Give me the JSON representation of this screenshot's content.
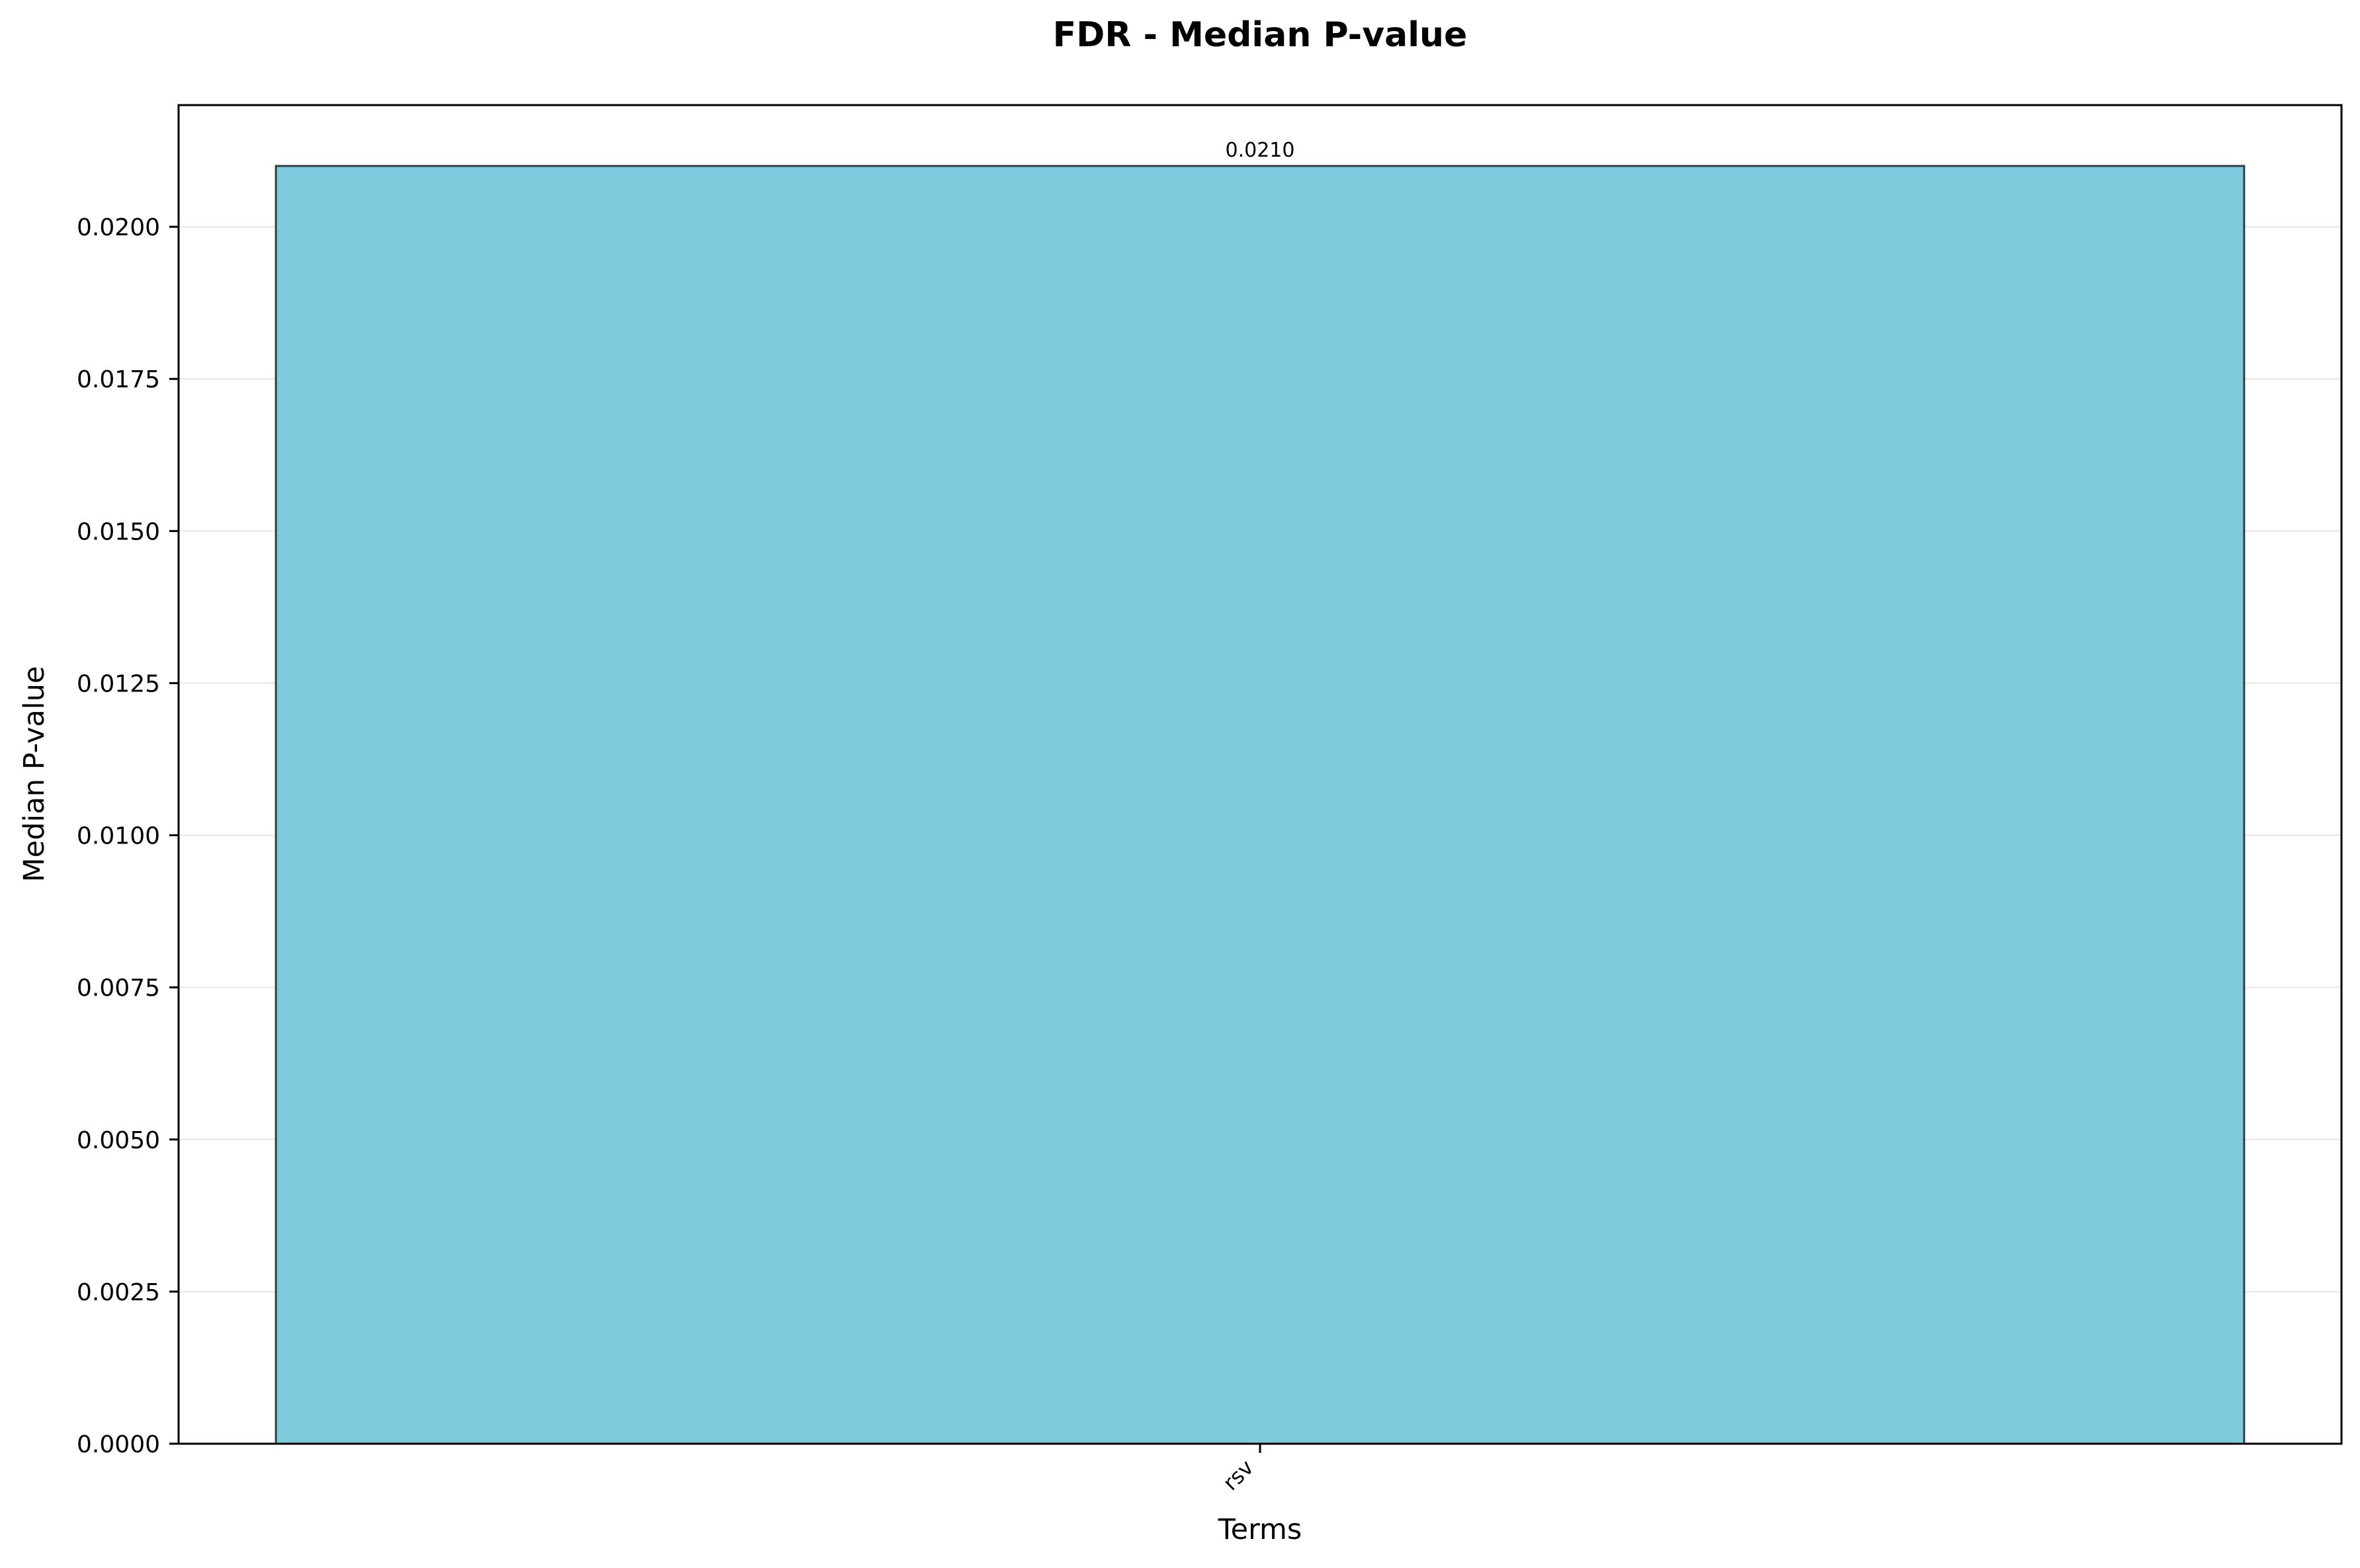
{
  "chart_data": {
    "type": "bar",
    "title": "FDR - Median P-value",
    "xlabel": "Terms",
    "ylabel": "Median P-value",
    "categories": [
      "rsv"
    ],
    "values": [
      0.021
    ],
    "data_labels": [
      "0.0210"
    ],
    "ylim": [
      0,
      0.022
    ],
    "yticks": [
      0.0,
      0.0025,
      0.005,
      0.0075,
      0.01,
      0.0125,
      0.015,
      0.0175,
      0.02
    ],
    "ytick_labels": [
      "0.0000",
      "0.0025",
      "0.0050",
      "0.0075",
      "0.0100",
      "0.0125",
      "0.0150",
      "0.0175",
      "0.0200"
    ],
    "grid": "y",
    "legend": "none",
    "colors": {
      "bar_fill": "#7ecadd",
      "bar_edge": "#2f3f44",
      "grid": "#e6e6e6",
      "axis": "#000000"
    }
  }
}
